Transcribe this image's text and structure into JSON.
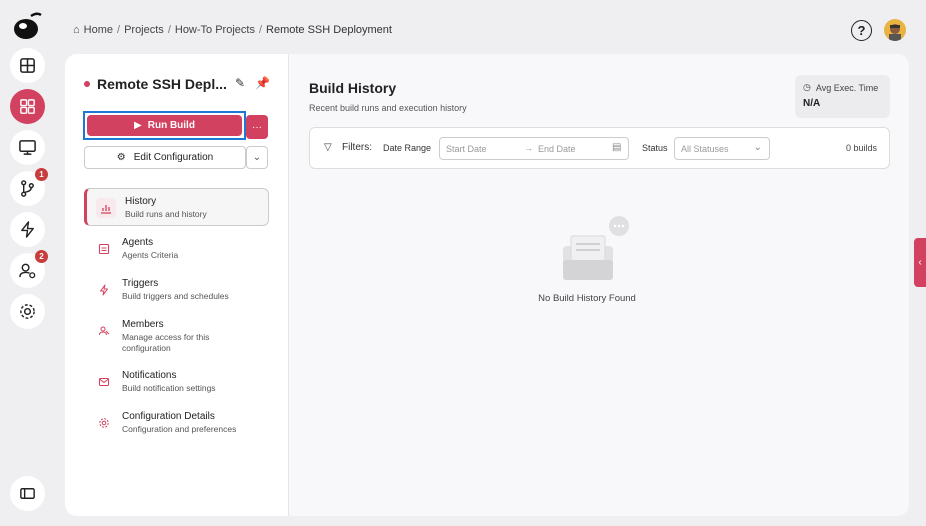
{
  "breadcrumb": {
    "items": [
      "Home",
      "Projects",
      "How-To Projects",
      "Remote SSH Deployment"
    ],
    "separator": "/"
  },
  "rail": {
    "items": [
      {
        "icon": "layout-icon",
        "active": false
      },
      {
        "icon": "dashboard-grid-icon",
        "active": true
      },
      {
        "icon": "monitor-icon",
        "active": false
      },
      {
        "icon": "git-branch-icon",
        "active": false,
        "badge": "1"
      },
      {
        "icon": "lightning-icon",
        "active": false
      },
      {
        "icon": "user-settings-icon",
        "active": false,
        "badge": "2"
      },
      {
        "icon": "gear-icon",
        "active": false
      },
      {
        "icon": "sidebar-toggle-icon",
        "active": false
      }
    ]
  },
  "project": {
    "name": "Remote SSH Depl...",
    "run_label": "Run Build",
    "more_label": "···",
    "edit_config_label": "Edit Configuration"
  },
  "nav": [
    {
      "title": "History",
      "subtitle": "Build runs and history",
      "icon": "chart-icon",
      "active": true
    },
    {
      "title": "Agents",
      "subtitle": "Agents Criteria",
      "icon": "agent-icon",
      "active": false
    },
    {
      "title": "Triggers",
      "subtitle": "Build triggers and schedules",
      "icon": "lightning-icon",
      "active": false
    },
    {
      "title": "Members",
      "subtitle": "Manage access for this configuration",
      "icon": "members-icon",
      "active": false
    },
    {
      "title": "Notifications",
      "subtitle": "Build notification settings",
      "icon": "mail-icon",
      "active": false
    },
    {
      "title": "Configuration Details",
      "subtitle": "Configuration and preferences",
      "icon": "gear-icon",
      "active": false
    }
  ],
  "history": {
    "title": "Build History",
    "subtitle": "Recent build runs and execution history",
    "avg_label": "Avg Exec. Time",
    "avg_value": "N/A",
    "filters_label": "Filters:",
    "date_range_label": "Date Range",
    "start_placeholder": "Start Date",
    "end_placeholder": "End Date",
    "status_label": "Status",
    "status_value": "All Statuses",
    "count": "0 builds",
    "empty_text": "No Build History Found"
  },
  "colors": {
    "accent": "#d2415f",
    "focus": "#1e78d2"
  }
}
